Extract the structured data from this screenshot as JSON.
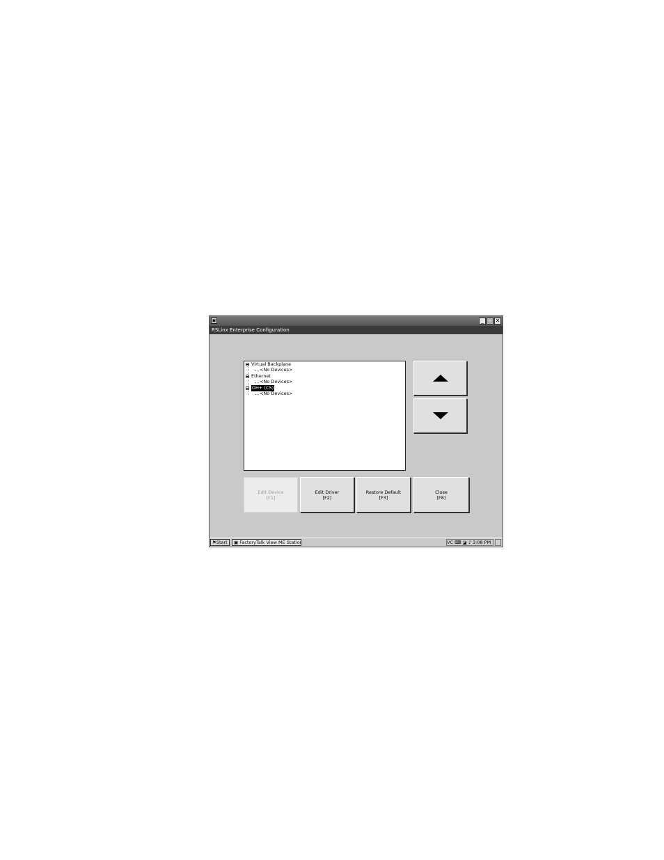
{
  "window": {
    "icon": "factorytalk-app-icon",
    "app_title": "RSLinx Enterprise Configuration",
    "controls": {
      "minimize": "_",
      "maximize": "□",
      "close": "✕"
    }
  },
  "tree": {
    "nodes": [
      {
        "label": "Virtual Backplane",
        "expanded": true,
        "children": [
          "<No Devices>"
        ]
      },
      {
        "label": "Ethernet",
        "expanded": true,
        "children": [
          "<No Devices>"
        ]
      },
      {
        "label": "DH+ (C5)",
        "expanded": true,
        "selected": true,
        "children": [
          "<No Devices>"
        ]
      }
    ]
  },
  "scroll": {
    "up_icon": "arrow-up-icon",
    "down_icon": "arrow-down-icon"
  },
  "buttons": {
    "edit_device": {
      "label": "Edit Device",
      "key": "[F1]",
      "disabled": true
    },
    "edit_driver": {
      "label": "Edit Driver",
      "key": "[F2]"
    },
    "restore_default": {
      "label": "Restore Default",
      "key": "[F3]"
    },
    "close": {
      "label": "Close",
      "key": "[F8]"
    }
  },
  "taskbar": {
    "start_label": "Start",
    "task_label": "FactoryTalk View ME Station",
    "tray": {
      "vc_label": "VC",
      "time": "3:08 PM"
    }
  }
}
